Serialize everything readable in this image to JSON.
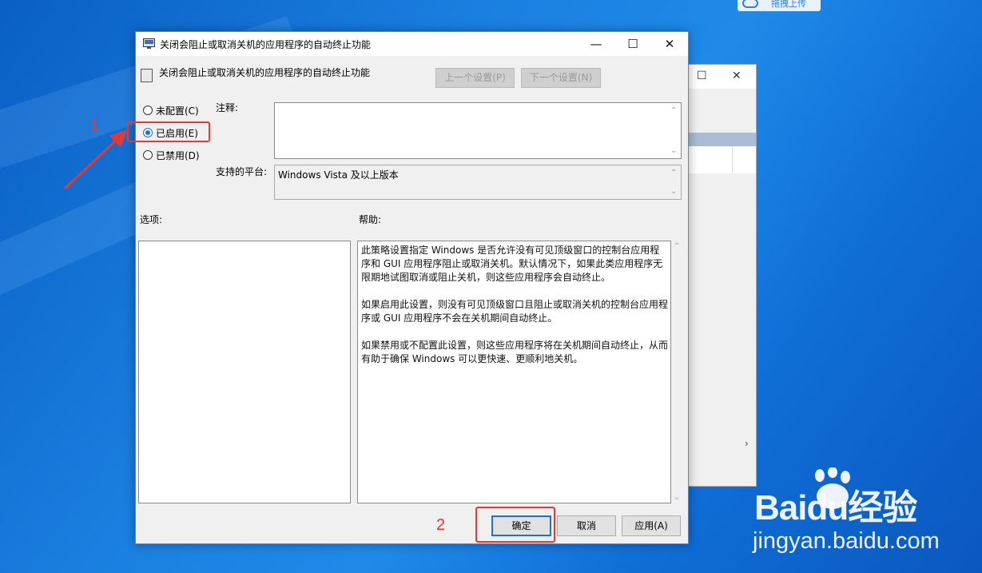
{
  "upload_chip": {
    "label": "拖拽上传"
  },
  "dialog": {
    "title": "关闭会阻止或取消关机的应用程序的自动终止功能",
    "header_title": "关闭会阻止或取消关机的应用程序的自动终止功能",
    "prev_setting": "上一个设置(P)",
    "next_setting": "下一个设置(N)",
    "radios": [
      {
        "label": "未配置(C)",
        "checked": false
      },
      {
        "label": "已启用(E)",
        "checked": true
      },
      {
        "label": "已禁用(D)",
        "checked": false
      }
    ],
    "comment_label": "注释:",
    "platform_label": "支持的平台:",
    "platform_value": "Windows Vista 及以上版本",
    "options_label": "选项:",
    "help_label": "帮助:",
    "help_paragraphs": [
      "此策略设置指定 Windows 是否允许没有可见顶级窗口的控制台应用程序和 GUI 应用程序阻止或取消关机。默认情况下，如果此类应用程序无限期地试图取消或阻止关机，则这些应用程序会自动终止。",
      "如果启用此设置，则没有可见顶级窗口且阻止或取消关机的控制台应用程序或 GUI 应用程序不会在关机期间自动终止。",
      "如果禁用或不配置此设置，则这些应用程序将在关机期间自动终止，从而有助于确保 Windows 可以更快速、更顺利地关机。"
    ],
    "ok_button": "确定",
    "cancel_button": "取消",
    "apply_button": "应用(A)"
  },
  "annotations": {
    "step1": "1",
    "step2": "2",
    "accent": "#e53935"
  },
  "watermark": {
    "logo": "Baidu经验",
    "url": "jingyan.baidu.com"
  },
  "colors": {
    "radio_accent": "#1f6fd4",
    "desktop": "#1a7fe0"
  }
}
